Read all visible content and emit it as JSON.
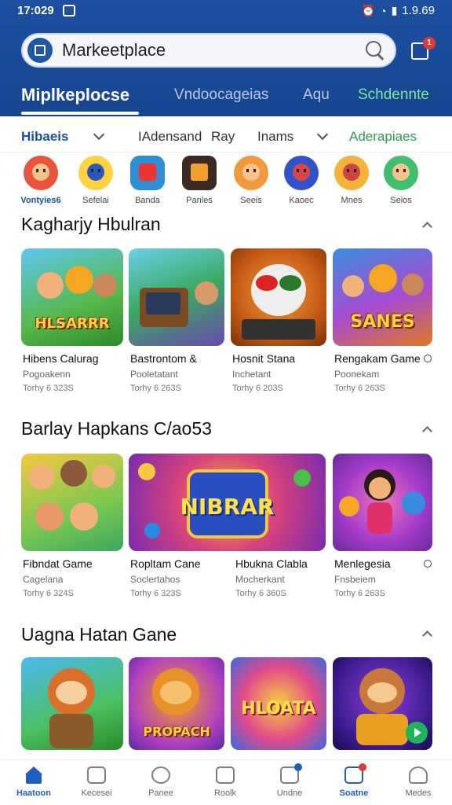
{
  "status": {
    "time": "17:029",
    "right_time": "1.9.69"
  },
  "search": {
    "label": "Markeetplace"
  },
  "notification": {
    "badge": "1"
  },
  "tabs": [
    {
      "label": "Miplkeplocse"
    },
    {
      "label": "Vndoocageias"
    },
    {
      "label": "Aqu"
    },
    {
      "label": "Schdennte"
    }
  ],
  "filters": [
    {
      "label": "Hibaeis"
    },
    {
      "label": "IAdensand"
    },
    {
      "label": "Ray"
    },
    {
      "label": "Inams"
    },
    {
      "label": "Aderapiaes"
    }
  ],
  "categories": [
    {
      "label": "Vontyies6"
    },
    {
      "label": "Sefelai"
    },
    {
      "label": "Banda"
    },
    {
      "label": "Panles"
    },
    {
      "label": "Seeis"
    },
    {
      "label": "Kaoec"
    },
    {
      "label": "Mnes"
    },
    {
      "label": "Seios"
    }
  ],
  "sections": [
    {
      "title": "Kagharjy Hbulran",
      "cards": [
        {
          "art": "HLSARRR",
          "title": "Hibens Calurag",
          "sub1": "Pogoakenn",
          "sub2": "Torhy 6 323S"
        },
        {
          "art": "",
          "title": "Bastrontom &",
          "sub1": "Pooletatant",
          "sub2": "Torhy 6 263S"
        },
        {
          "art": "",
          "title": "Hosnit Stana",
          "sub1": "Inchetant",
          "sub2": "Torhy 6 203S"
        },
        {
          "art": "SANES",
          "title": "Rengakam Game",
          "sub1": "Poonekam",
          "sub2": "Torhy 6 263S"
        }
      ]
    },
    {
      "title": "Barlay Hapkans C/ao53",
      "cards": [
        {
          "art": "",
          "title": "Fibndat Game",
          "sub1": "Cagelana",
          "sub2": "Torhy 6 324S"
        },
        {
          "art": "NIBRAR",
          "title": "Ropltam Cane",
          "sub1": "Soclertahos",
          "sub2": "Torhy 6 323S"
        },
        {
          "art": "",
          "title": "Hbukna Clabla",
          "sub1": "Mocherkant",
          "sub2": "Torhy 6 360S"
        },
        {
          "art": "",
          "title": "Menlegesia",
          "sub1": "Fnsbeiem",
          "sub2": "Torhy 6 263S"
        }
      ]
    },
    {
      "title": "Uagna Hatan Gane",
      "cards": [
        {
          "art": ""
        },
        {
          "art": "PROPACH"
        },
        {
          "art": "HLOATA"
        },
        {
          "art": ""
        }
      ]
    }
  ],
  "bottom_nav": [
    {
      "label": "Haatoon"
    },
    {
      "label": "Kecesei"
    },
    {
      "label": "Panee"
    },
    {
      "label": "Roolk"
    },
    {
      "label": "Undne"
    },
    {
      "label": "Soatne"
    },
    {
      "label": "Medes"
    }
  ]
}
